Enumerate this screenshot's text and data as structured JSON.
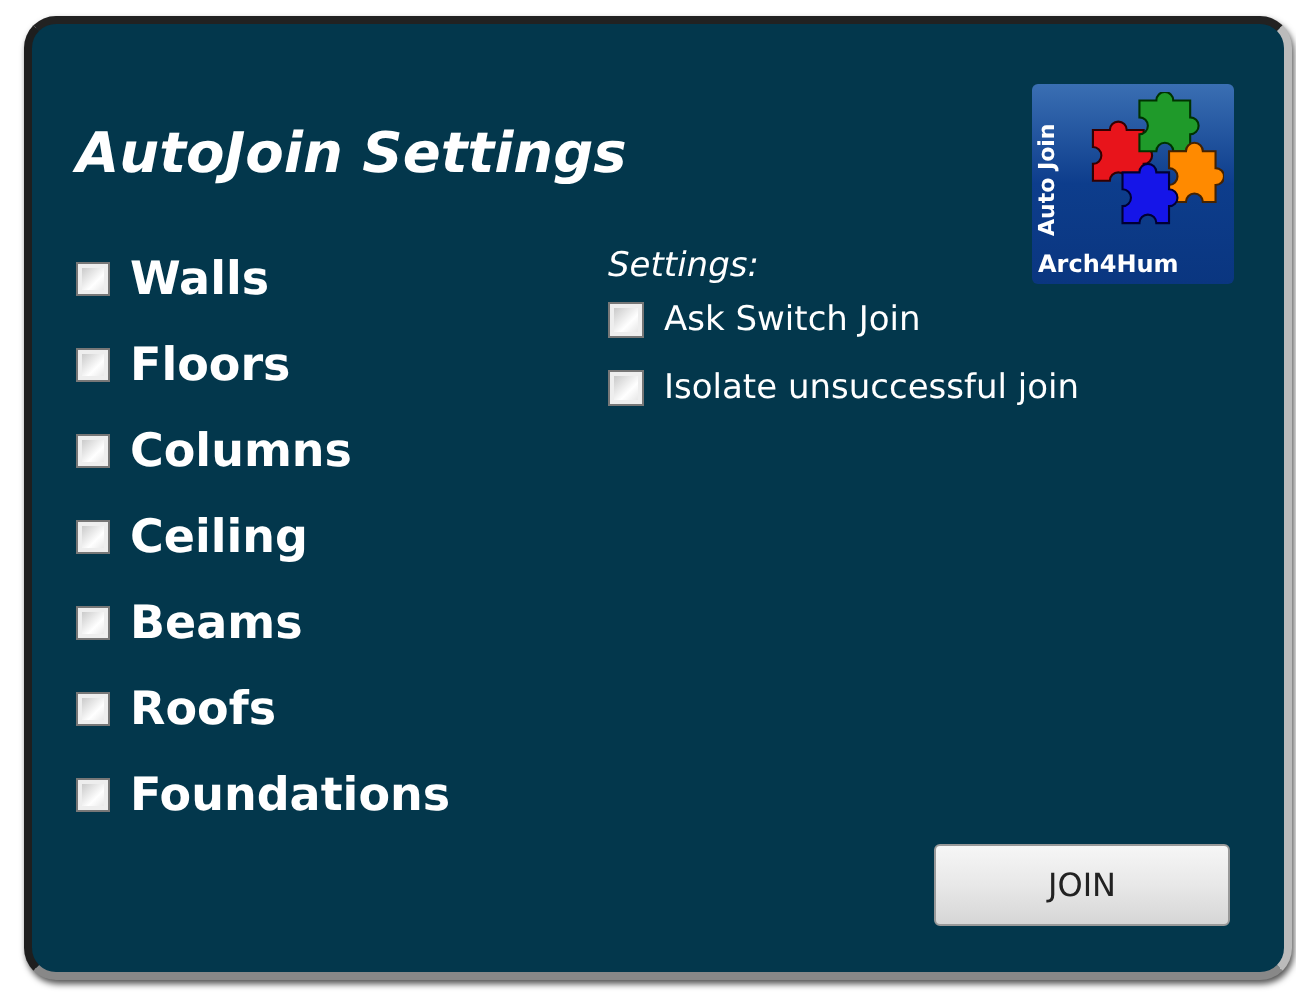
{
  "title": "AutoJoin Settings",
  "logo": {
    "side_text": "Auto Join",
    "caption": "Arch4Hum"
  },
  "elements": [
    {
      "label": "Walls",
      "checked": false
    },
    {
      "label": "Floors",
      "checked": false
    },
    {
      "label": "Columns",
      "checked": false
    },
    {
      "label": "Ceiling",
      "checked": false
    },
    {
      "label": "Beams",
      "checked": false
    },
    {
      "label": "Roofs",
      "checked": false
    },
    {
      "label": "Foundations",
      "checked": false
    }
  ],
  "settings": {
    "heading": "Settings:",
    "options": [
      {
        "label": "Ask Switch Join",
        "checked": false
      },
      {
        "label": "Isolate unsuccessful join",
        "checked": false
      }
    ]
  },
  "button": {
    "label": "JOIN"
  }
}
